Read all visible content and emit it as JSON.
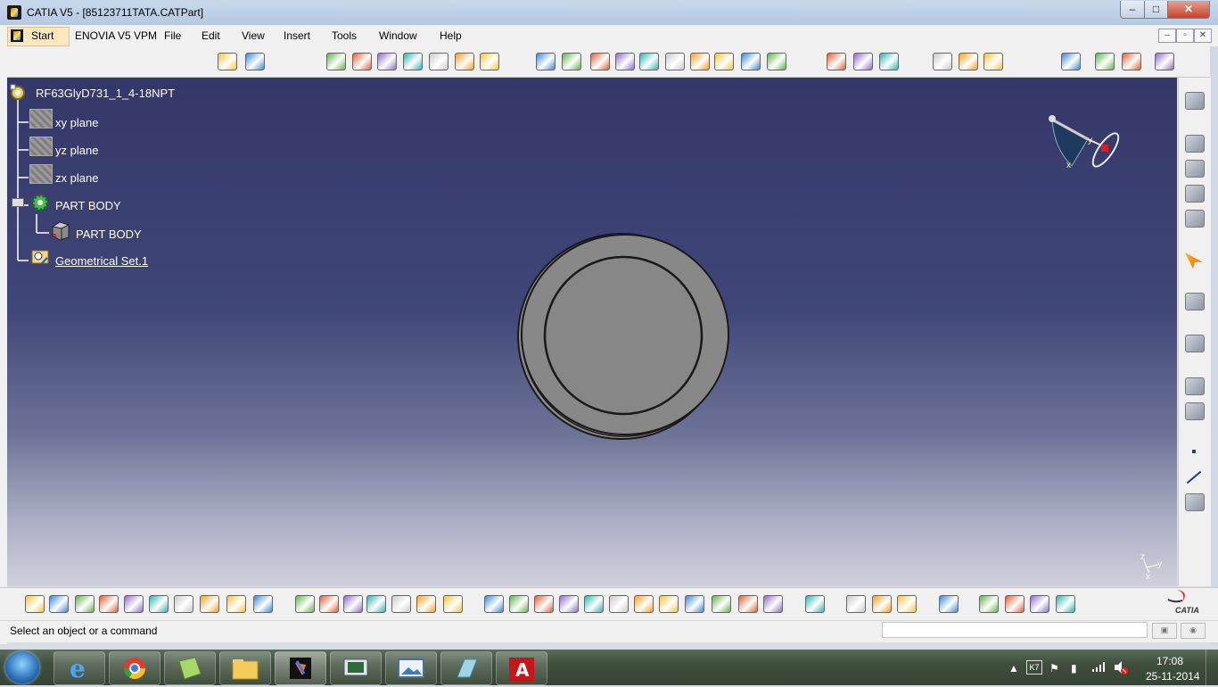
{
  "window": {
    "title": "CATIA V5 - [85123711TATA.CATPart]",
    "min": "–",
    "max": "□",
    "close": "✕"
  },
  "menu": {
    "start": "Start",
    "items": [
      "ENOVIA V5 VPM",
      "File",
      "Edit",
      "View",
      "Insert",
      "Tools",
      "Window",
      "Help"
    ],
    "doc_min": "–",
    "doc_restore": "▫",
    "doc_close": "✕"
  },
  "tree": {
    "root": "RF63GlyD731_1_4-18NPT",
    "xy": "xy plane",
    "yz": "yz plane",
    "zx": "zx plane",
    "partbody": "PART BODY",
    "partbody_child": "PART BODY",
    "geoset": "Geometrical Set.1"
  },
  "compass": {
    "x": "x",
    "y": "y"
  },
  "axis": {
    "z": "z",
    "y": "y",
    "x": "x"
  },
  "brand": {
    "catia": "CATIA"
  },
  "status": {
    "prompt": "Select an object or a command",
    "command_value": ""
  },
  "taskbar": {
    "time": "17:08",
    "date": "25-11-2014",
    "tray_k7": "K7"
  },
  "icons": {
    "top_toolbar": [
      "sketch-icon",
      "sketch-options-icon",
      "pad-icon",
      "pocket-icon",
      "shaft-icon",
      "groove-icon",
      "hole-icon",
      "rib-icon",
      "slot-icon",
      "fillet-icon",
      "chamfer-icon",
      "draft-icon",
      "shell-icon",
      "thickness-icon",
      "thread-icon",
      "mirror-icon",
      "pattern-icon",
      "scaling-icon",
      "split-icon",
      "thick-surface-icon",
      "close-surface-icon",
      "sew-surface-icon",
      "boolean-add-icon",
      "annotation-icon",
      "constraint-icon",
      "measure-icon",
      "material-icon",
      "catalog-icon",
      "apply-material-icon",
      "analysis-icon",
      "grid-icon",
      "snap-icon"
    ],
    "bottom_toolbar": [
      "new-icon",
      "open-icon",
      "save-icon",
      "print-icon",
      "cut-icon",
      "copy-icon",
      "paste-icon",
      "undo-icon",
      "redo-icon",
      "whats-this-icon",
      "formula-icon",
      "comment-icon",
      "link-icon",
      "table-icon",
      "knowledge-icon",
      "lock-icon",
      "update-icon",
      "fly-mode-icon",
      "fit-all-icon",
      "pan-icon",
      "rotate-icon",
      "zoom-in-icon",
      "zoom-out-icon",
      "normal-view-icon",
      "multi-view-icon",
      "iso-view-icon",
      "shading-icon",
      "hide-show-icon",
      "swap-space-icon",
      "measure-between-icon",
      "measure-item-icon",
      "measure-inertia-icon",
      "capture-icon",
      "apply-material-icon",
      "catalog-browser-icon",
      "render-icon",
      "layer-icon",
      "magnifier-icon"
    ]
  }
}
